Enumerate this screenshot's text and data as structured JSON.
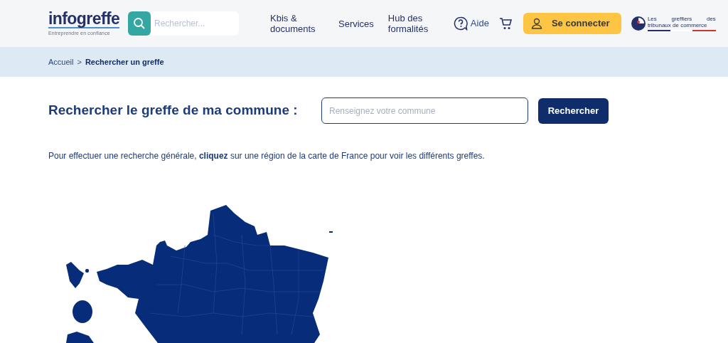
{
  "header": {
    "logo": {
      "name": "infogreffe",
      "tagline": "Entreprendre en confiance"
    },
    "search": {
      "placeholder": "Rechercher..."
    },
    "nav": [
      {
        "label": "Kbis & documents"
      },
      {
        "label": "Services"
      },
      {
        "label": "Hub des formalités"
      }
    ],
    "help": "Aide",
    "login": "Se connecter",
    "partner": {
      "line1": [
        "Les",
        "greffiers",
        "des"
      ],
      "line2": "tribunaux de commerce"
    }
  },
  "breadcrumb": [
    {
      "label": "Accueil",
      "current": false
    },
    {
      "label": "Rechercher un greffe",
      "current": true
    }
  ],
  "breadcrumb_separator": ">",
  "search_section": {
    "title": "Rechercher le greffe de ma commune :",
    "placeholder": "Renseignez votre commune",
    "button": "Rechercher"
  },
  "intro": "Pour effectuer une recherche générale, **cliquez** sur une région de la carte de France pour voir les différents greffes."
}
